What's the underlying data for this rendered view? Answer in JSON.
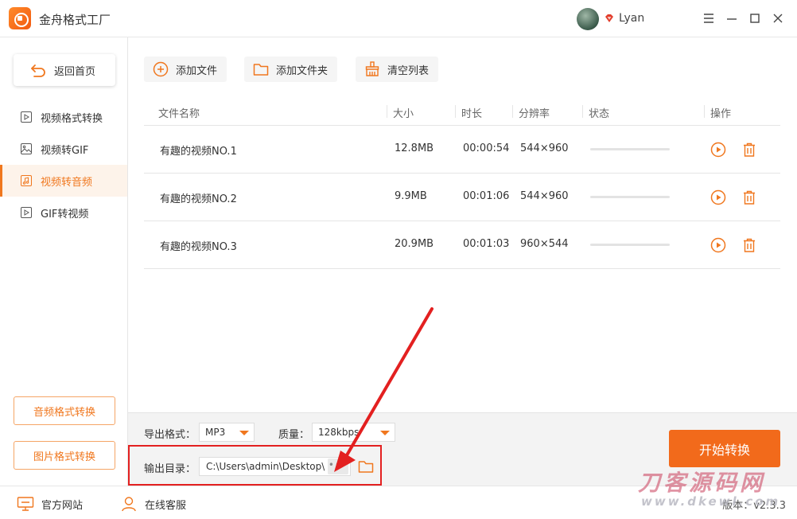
{
  "app": {
    "title": "金舟格式工厂",
    "user_name": "Lyan"
  },
  "sidebar": {
    "home_label": "返回首页",
    "items": [
      {
        "label": "视频格式转换"
      },
      {
        "label": "视频转GIF"
      },
      {
        "label": "视频转音频"
      },
      {
        "label": "GIF转视频"
      }
    ],
    "active_index": 2,
    "bottom_buttons": [
      {
        "label": "音频格式转换"
      },
      {
        "label": "图片格式转换"
      }
    ]
  },
  "toolbar": {
    "add_file": "添加文件",
    "add_folder": "添加文件夹",
    "clear_list": "清空列表"
  },
  "table": {
    "headers": [
      "文件名称",
      "大小",
      "时长",
      "分辨率",
      "状态",
      "操作"
    ],
    "rows": [
      {
        "name": "有趣的视频NO.1",
        "size": "12.8MB",
        "duration": "00:00:54",
        "resolution": "544×960",
        "progress": 0
      },
      {
        "name": "有趣的视频NO.2",
        "size": "9.9MB",
        "duration": "00:01:06",
        "resolution": "544×960",
        "progress": 0
      },
      {
        "name": "有趣的视频NO.3",
        "size": "20.9MB",
        "duration": "00:01:03",
        "resolution": "960×544",
        "progress": 0
      }
    ]
  },
  "bottom": {
    "format_label": "导出格式：",
    "format_value": "MP3",
    "quality_label": "质量：",
    "quality_value": "128kbps",
    "dir_label": "输出目录：",
    "dir_value": "C:\\Users\\admin\\Desktop\\",
    "dots": "•••",
    "start_label": "开始转换"
  },
  "footer": {
    "website": "官方网站",
    "support": "在线客服",
    "version": "版本：v2.3.3"
  },
  "watermark": {
    "line1": "刀客源码网",
    "line2": "www.dkewl.com"
  },
  "colors": {
    "accent": "#f0771e",
    "start_button": "#f26a1b",
    "highlight": "#e32020"
  }
}
